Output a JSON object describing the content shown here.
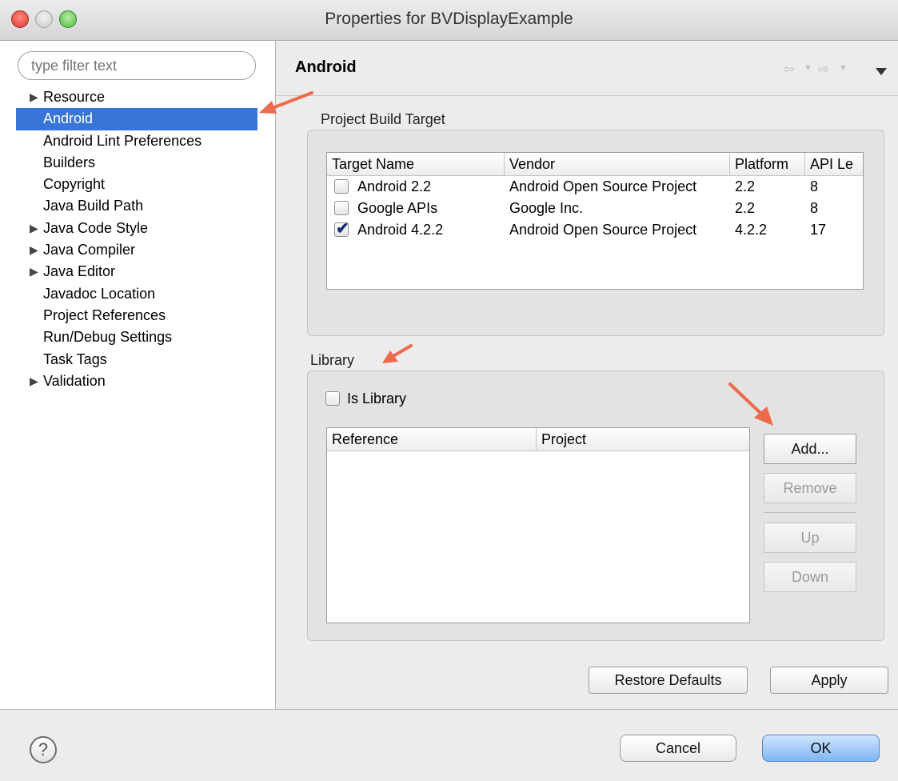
{
  "window": {
    "title": "Properties for BVDisplayExample"
  },
  "filter": {
    "placeholder": "type filter text"
  },
  "tree": {
    "items": [
      {
        "label": "Resource",
        "expandable": true,
        "selected": false
      },
      {
        "label": "Android",
        "expandable": false,
        "selected": true
      },
      {
        "label": "Android Lint Preferences",
        "expandable": false,
        "selected": false
      },
      {
        "label": "Builders",
        "expandable": false,
        "selected": false
      },
      {
        "label": "Copyright",
        "expandable": false,
        "selected": false
      },
      {
        "label": "Java Build Path",
        "expandable": false,
        "selected": false
      },
      {
        "label": "Java Code Style",
        "expandable": true,
        "selected": false
      },
      {
        "label": "Java Compiler",
        "expandable": true,
        "selected": false
      },
      {
        "label": "Java Editor",
        "expandable": true,
        "selected": false
      },
      {
        "label": "Javadoc Location",
        "expandable": false,
        "selected": false
      },
      {
        "label": "Project References",
        "expandable": false,
        "selected": false
      },
      {
        "label": "Run/Debug Settings",
        "expandable": false,
        "selected": false
      },
      {
        "label": "Task Tags",
        "expandable": false,
        "selected": false
      },
      {
        "label": "Validation",
        "expandable": true,
        "selected": false
      }
    ]
  },
  "page": {
    "title": "Android"
  },
  "build_target": {
    "group_label": "Project Build Target",
    "columns": [
      "Target Name",
      "Vendor",
      "Platform",
      "API Le"
    ],
    "rows": [
      {
        "checked": false,
        "name": "Android 2.2",
        "vendor": "Android Open Source Project",
        "platform": "2.2",
        "api": "8"
      },
      {
        "checked": false,
        "name": "Google APIs",
        "vendor": "Google Inc.",
        "platform": "2.2",
        "api": "8"
      },
      {
        "checked": true,
        "name": "Android 4.2.2",
        "vendor": "Android Open Source Project",
        "platform": "4.2.2",
        "api": "17"
      }
    ]
  },
  "library": {
    "group_label": "Library",
    "is_library_label": "Is Library",
    "is_library_checked": false,
    "columns": [
      "Reference",
      "Project"
    ],
    "buttons": {
      "add": "Add...",
      "remove": "Remove",
      "up": "Up",
      "down": "Down"
    }
  },
  "actions": {
    "restore_defaults": "Restore Defaults",
    "apply": "Apply"
  },
  "footer": {
    "cancel": "Cancel",
    "ok": "OK",
    "help_glyph": "?"
  },
  "icons": {
    "back": "back-arrow-icon",
    "forward": "forward-arrow-icon",
    "dropdown": "chevron-down-icon",
    "menu": "view-menu-icon",
    "help": "help-icon",
    "expand": "disclosure-triangle-icon"
  },
  "colors": {
    "selection": "#3875d7",
    "annotation_arrow": "#ee6a4c",
    "default_button": "#7fb5f2"
  }
}
